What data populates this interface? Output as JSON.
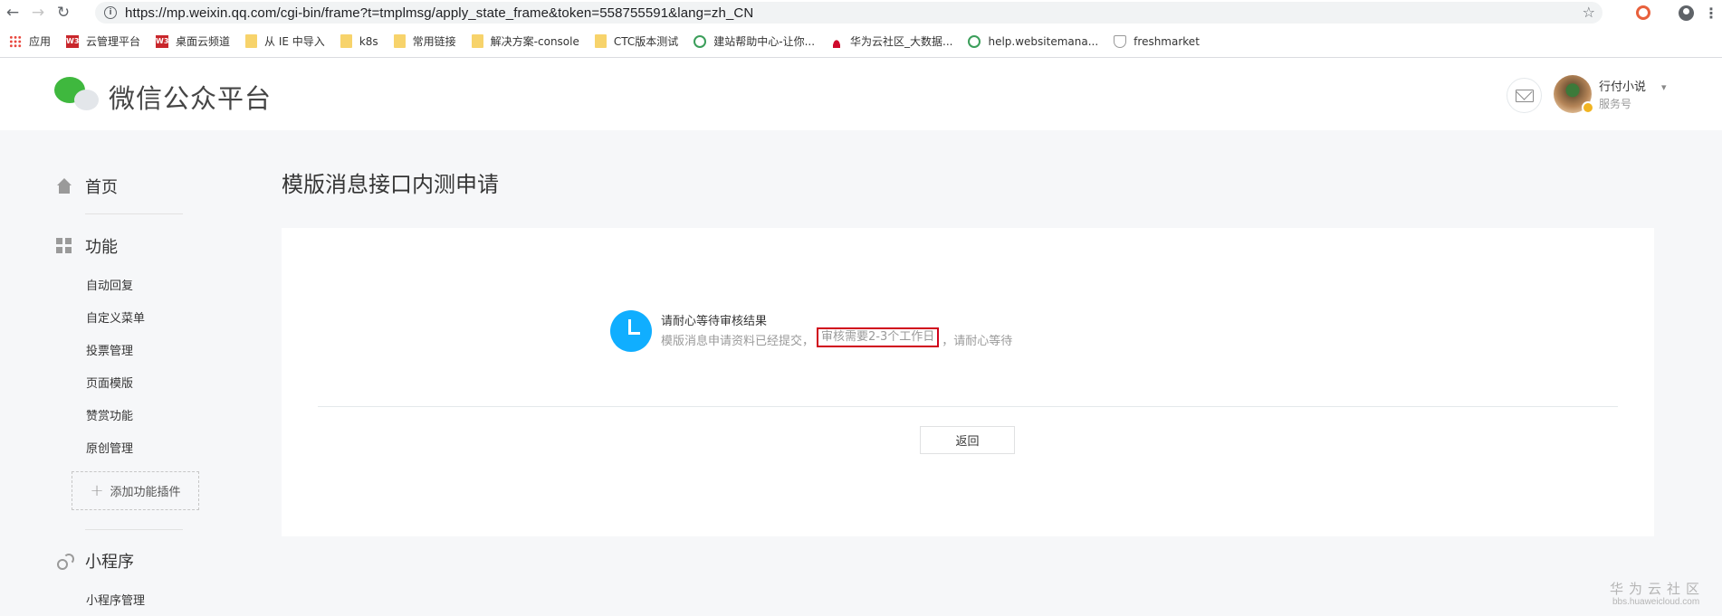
{
  "browser": {
    "url": "https://mp.weixin.qq.com/cgi-bin/frame?t=tmplmsg/apply_state_frame&token=558755591&lang=zh_CN",
    "bookmarks": [
      {
        "label": "应用",
        "icon": "apps-grid-icon"
      },
      {
        "label": "云管理平台",
        "icon": "w3-icon"
      },
      {
        "label": "桌面云频道",
        "icon": "w3-icon"
      },
      {
        "label": "从 IE 中导入",
        "icon": "folder-icon"
      },
      {
        "label": "k8s",
        "icon": "folder-icon"
      },
      {
        "label": "常用链接",
        "icon": "folder-icon"
      },
      {
        "label": "解决方案-console",
        "icon": "folder-icon"
      },
      {
        "label": "CTC版本测试",
        "icon": "folder-icon"
      },
      {
        "label": "建站帮助中心-让你...",
        "icon": "site-icon"
      },
      {
        "label": "华为云社区_大数据...",
        "icon": "huawei-icon"
      },
      {
        "label": "help.websitemana...",
        "icon": "site-icon"
      },
      {
        "label": "freshmarket",
        "icon": "shield-icon"
      }
    ]
  },
  "header": {
    "brand": "微信公众平台",
    "account_name": "行付小说",
    "account_type": "服务号"
  },
  "sidebar": {
    "home": "首页",
    "features": "功能",
    "feature_items": [
      "自动回复",
      "自定义菜单",
      "投票管理",
      "页面模版",
      "赞赏功能",
      "原创管理"
    ],
    "add_plugin": "添加功能插件",
    "miniprogram": "小程序",
    "miniprogram_items": [
      "小程序管理"
    ]
  },
  "main": {
    "title": "模版消息接口内测申请",
    "status_title": "请耐心等待审核结果",
    "desc_before": "模版消息申请资料已经提交，",
    "desc_highlight": "审核需要2-3个工作日",
    "desc_after": "，请耐心等待",
    "back_button": "返回"
  },
  "watermark": {
    "title": "华为云社区",
    "url": "bbs.huaweicloud.com"
  },
  "colors": {
    "accent_blue": "#10aeff",
    "highlight_red": "#d0021b",
    "brand_green": "#3fb83e"
  }
}
